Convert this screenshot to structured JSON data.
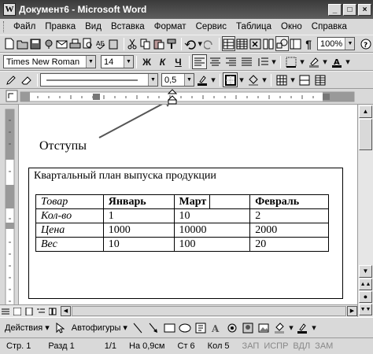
{
  "window": {
    "title": "Документ6 - Microsoft Word",
    "app_icon": "W",
    "controls": [
      "_",
      "□",
      "×"
    ]
  },
  "menu": [
    "Файл",
    "Правка",
    "Вид",
    "Вставка",
    "Формат",
    "Сервис",
    "Таблица",
    "Окно",
    "Справка"
  ],
  "standard_toolbar": {
    "zoom": "100%"
  },
  "format_toolbar": {
    "font": "Times New Roman",
    "size": "14",
    "bold": "Ж",
    "italic": "К",
    "underline": "Ч"
  },
  "tables_toolbar": {
    "line_weight": "0,5"
  },
  "document": {
    "annotation": "Отступы",
    "heading": "Квартальный план выпуска продукции",
    "table": {
      "header": [
        "Товар",
        "Январь",
        "Март",
        "Февраль"
      ],
      "rows": [
        [
          "Кол-во",
          "1",
          "10",
          "2"
        ],
        [
          "Цена",
          "1000",
          "10000",
          "2000"
        ],
        [
          "Вес",
          "10",
          "100",
          "20"
        ]
      ]
    }
  },
  "drawing_toolbar": {
    "actions": "Действия",
    "autoshapes": "Автофигуры"
  },
  "status": {
    "page": "Стр. 1",
    "section": "Разд 1",
    "pages": "1/1",
    "at": "На 0,9см",
    "line": "Ст 6",
    "col": "Кол 5",
    "rec": "ЗАП",
    "trk": "ИСПР",
    "ext": "ВДЛ",
    "ovr": "ЗАМ"
  }
}
